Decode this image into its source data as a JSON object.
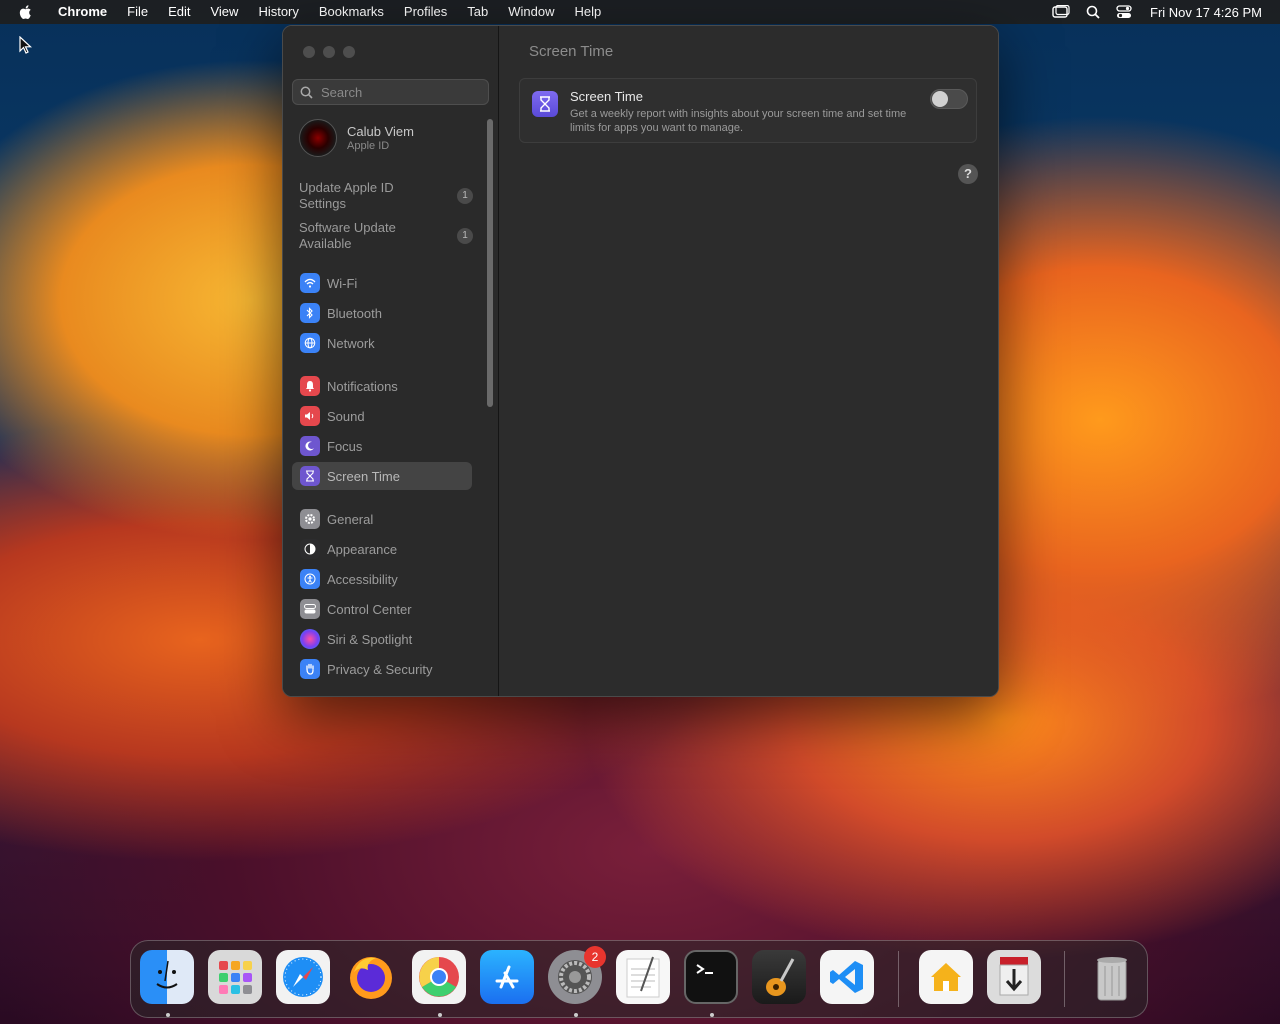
{
  "menubar": {
    "app": "Chrome",
    "items": [
      "File",
      "Edit",
      "View",
      "History",
      "Bookmarks",
      "Profiles",
      "Tab",
      "Window",
      "Help"
    ],
    "clock": "Fri Nov 17  4:26 PM"
  },
  "window": {
    "search": {
      "placeholder": "Search"
    },
    "profile": {
      "name": "Calub Viem",
      "subtitle": "Apple ID"
    },
    "notices": [
      {
        "label": "Update Apple ID Settings",
        "badge": "1"
      },
      {
        "label": "Software Update Available",
        "badge": "1"
      }
    ],
    "nav": [
      {
        "label": "Wi-Fi",
        "icon": "wifi-icon",
        "color": "#3b82f6"
      },
      {
        "label": "Bluetooth",
        "icon": "bluetooth-icon",
        "color": "#3b82f6"
      },
      {
        "label": "Network",
        "icon": "globe-icon",
        "color": "#3b82f6"
      },
      {
        "label": "Notifications",
        "icon": "bell-icon",
        "color": "#e5484d"
      },
      {
        "label": "Sound",
        "icon": "speaker-icon",
        "color": "#e5484d"
      },
      {
        "label": "Focus",
        "icon": "moon-icon",
        "color": "#6e56cf"
      },
      {
        "label": "Screen Time",
        "icon": "hourglass-icon",
        "color": "#6e56cf"
      },
      {
        "label": "General",
        "icon": "gear-icon",
        "color": "#8e8e93"
      },
      {
        "label": "Appearance",
        "icon": "appearance-icon",
        "color": "#2c2c2e"
      },
      {
        "label": "Accessibility",
        "icon": "accessibility-icon",
        "color": "#3b82f6"
      },
      {
        "label": "Control Center",
        "icon": "control-center-icon",
        "color": "#8e8e93"
      },
      {
        "label": "Siri & Spotlight",
        "icon": "siri-icon",
        "color": "#a855f7"
      },
      {
        "label": "Privacy & Security",
        "icon": "hand-icon",
        "color": "#3b82f6"
      }
    ],
    "selected": "Screen Time",
    "main": {
      "title": "Screen Time",
      "card": {
        "title": "Screen Time",
        "description": "Get a weekly report with insights about your screen time and set time limits for apps you want to manage.",
        "enabled": false
      },
      "help": "?"
    }
  },
  "dock": {
    "apps": [
      "Finder",
      "Launchpad",
      "Safari",
      "Firefox",
      "Google Chrome",
      "App Store",
      "System Settings",
      "TextEdit",
      "Terminal",
      "GarageBand",
      "Visual Studio Code",
      "Home",
      "Downloader",
      "Trash"
    ],
    "system_settings_badge": "2"
  }
}
